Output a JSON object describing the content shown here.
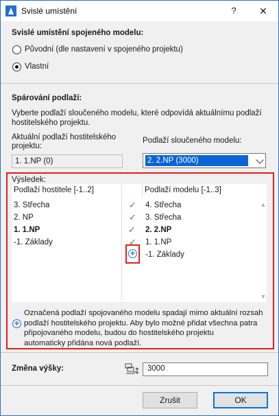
{
  "window": {
    "title": "Svislé umístění",
    "help_glyph": "?",
    "close_glyph": "✕"
  },
  "placement": {
    "heading": "Svislé umístění spojeného modelu:",
    "options": [
      {
        "label": "Původní (dle nastavení v spojeného projektu)",
        "selected": false
      },
      {
        "label": "Vlastní",
        "selected": true
      }
    ]
  },
  "pairing": {
    "heading": "Spárování podlaží:",
    "description_line1": "Vyberte podlaží sloučeného modelu, které odpovídá aktuálnímu podlaží",
    "description_line2": "hostitelského projektu.",
    "host_label_line1": "Aktuální podlaží hostitelského",
    "host_label_line2": "projektu:",
    "host_value": "1. 1.NP (0)",
    "merged_label": "Podlaží sloučeného modelu:",
    "merged_value": "2. 2.NP (3000)"
  },
  "result": {
    "heading": "Výsledek:",
    "host_header": "Podlaží hostitele [-1..2]",
    "model_header": "Podlaží modelu [-1..3]",
    "host_rows": [
      "3. Střecha",
      "2. NP",
      "1. 1.NP",
      "-1. Základy"
    ],
    "model_rows": [
      "4. Střecha",
      "3. Střecha",
      "2. 2.NP",
      "1. 1.NP",
      "-1. Základy"
    ],
    "check_glyph": "✓",
    "plus_glyph": "+",
    "scroll_up": "▲",
    "scroll_down": "▼",
    "note_line1": "Označená podlaží spojovaného modelu spadají mimo aktuální rozsah",
    "note_line2": "podlaží hostitelského projektu. Aby bylo možné přidat všechna patra",
    "note_line3": "připojovaného modelu, budou do hostitelského projektu",
    "note_line4": "automaticky přidána nová podlaží."
  },
  "height": {
    "label": "Změna výšky:",
    "value": "3000"
  },
  "buttons": {
    "cancel": "Zrušit",
    "ok": "OK"
  },
  "colors": {
    "accent": "#0a64d6",
    "highlight_frame": "#e21d1d",
    "check": "#2a9a3a"
  }
}
